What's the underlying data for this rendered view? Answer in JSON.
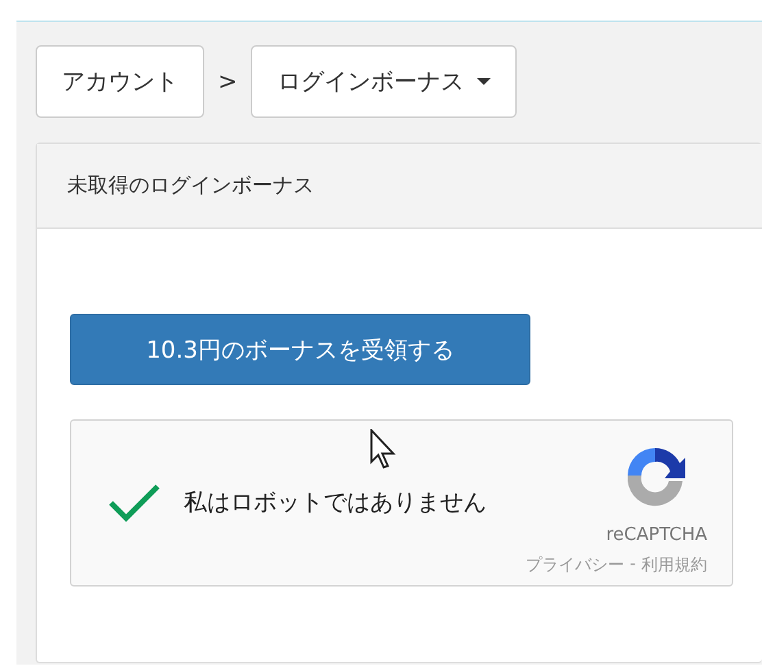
{
  "breadcrumb": {
    "items": [
      {
        "label": "アカウント",
        "dropdown": false
      },
      {
        "label": "ログインボーナス",
        "dropdown": true
      }
    ],
    "separator": ">"
  },
  "panel": {
    "title": "未取得のログインボーナス",
    "button": "10.3円のボーナスを受領する",
    "captcha": {
      "checked": true,
      "label": "私はロボットではありません",
      "brand": "reCAPTCHA",
      "links": [
        "プライバシー",
        "利用規約"
      ],
      "link_separator": "-"
    }
  }
}
